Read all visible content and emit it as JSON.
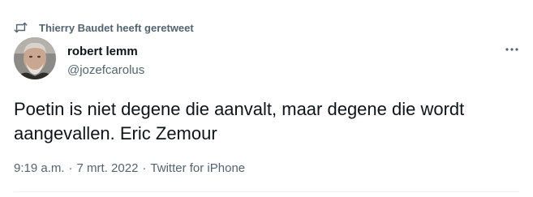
{
  "retweet": {
    "icon": "retweet-icon",
    "text": "Thierry Baudet heeft geretweet"
  },
  "author": {
    "avatar_icon": "avatar",
    "name": "robert lemm",
    "handle": "@jozefcarolus"
  },
  "more_icon": "more-options-icon",
  "tweet": {
    "text": "Poetin is niet degene die aanvalt, maar degene die wordt aangevallen. Eric Zemour"
  },
  "meta": {
    "time": "9:19 a.m.",
    "separator": "·",
    "date": "7 mrt. 2022",
    "source": "Twitter for iPhone"
  },
  "colors": {
    "text_primary": "#0f1419",
    "text_secondary": "#536471",
    "divider": "#eff3f4"
  }
}
